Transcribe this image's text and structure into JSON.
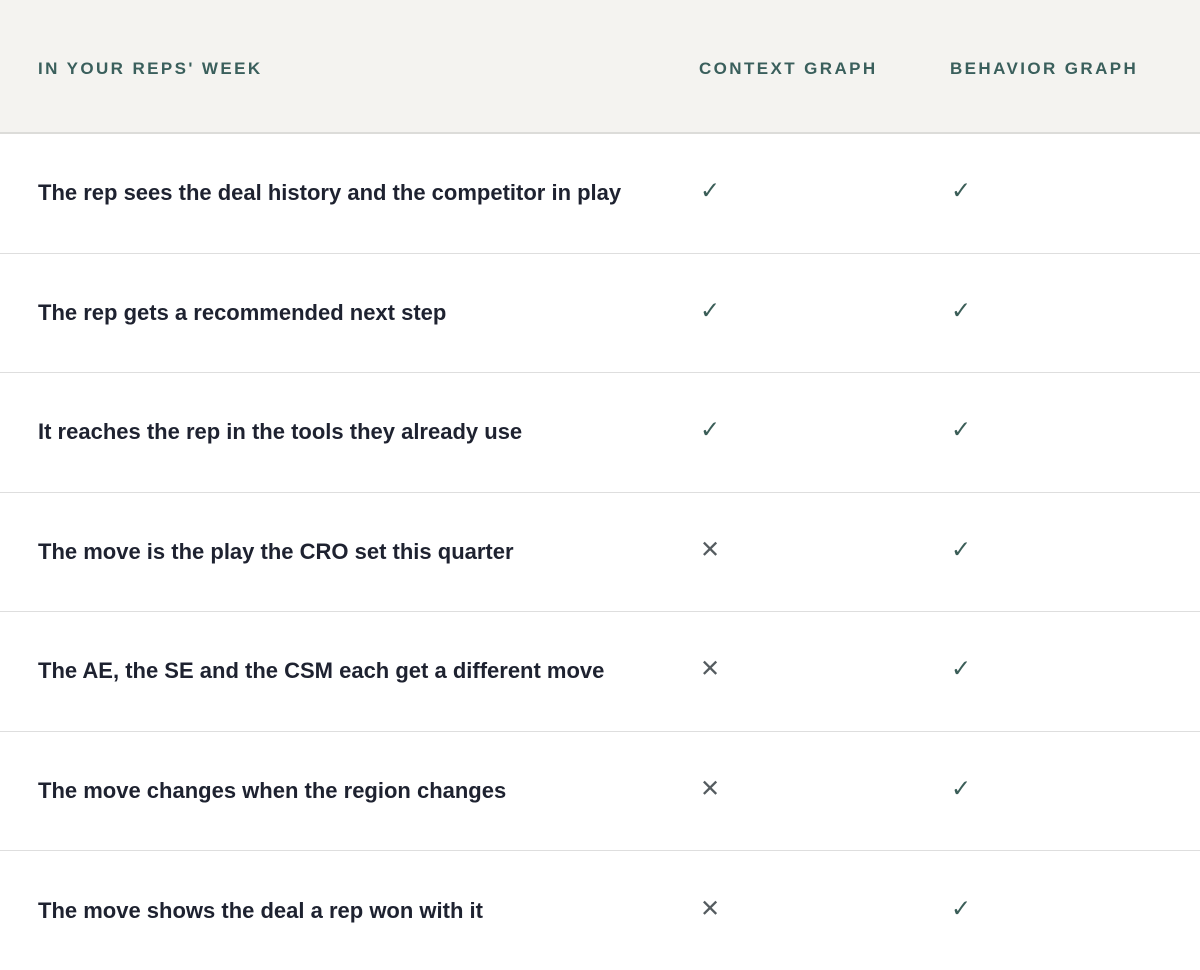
{
  "header": {
    "col0": "IN YOUR REPS' WEEK",
    "col1": "CONTEXT GRAPH",
    "col2": "BEHAVIOR GRAPH"
  },
  "symbols": {
    "check": "✓",
    "cross": "✕"
  },
  "colors": {
    "header_bg": "#f4f3f0",
    "header_text": "#3a5f5c",
    "row_text": "#1e2230",
    "check": "#3b5e58",
    "cross": "#555c60"
  },
  "rows": [
    {
      "label": "The rep sees the deal history and the competitor in play",
      "context": "✓",
      "behavior": "✓"
    },
    {
      "label": "The rep gets a recommended next step",
      "context": "✓",
      "behavior": "✓"
    },
    {
      "label": "It reaches the rep in the tools they already use",
      "context": "✓",
      "behavior": "✓"
    },
    {
      "label": "The move is the play the CRO set this quarter",
      "context": "✕",
      "behavior": "✓"
    },
    {
      "label": "The AE, the SE and the CSM each get a different move",
      "context": "✕",
      "behavior": "✓"
    },
    {
      "label": "The move changes when the region changes",
      "context": "✕",
      "behavior": "✓"
    },
    {
      "label": "The move shows the deal a rep won with it",
      "context": "✕",
      "behavior": "✓"
    }
  ]
}
